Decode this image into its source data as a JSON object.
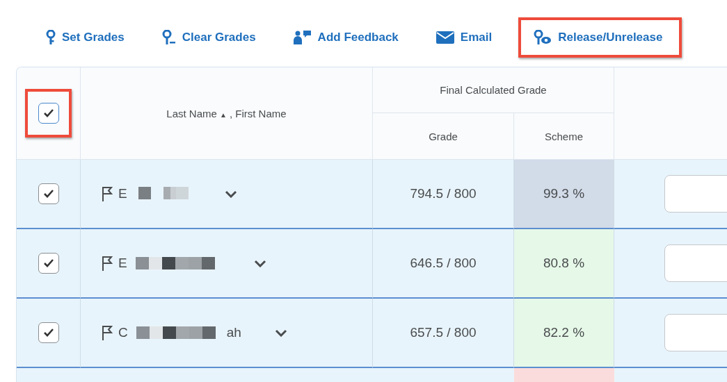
{
  "toolbar": [
    {
      "kind": "pin",
      "label": "Set Grades",
      "highlighted": false
    },
    {
      "kind": "pin-minus",
      "label": "Clear Grades",
      "highlighted": false
    },
    {
      "kind": "feedback",
      "label": "Add Feedback",
      "highlighted": false
    },
    {
      "kind": "mail",
      "label": "Email",
      "highlighted": false
    },
    {
      "kind": "pin-eye",
      "label": "Release/Unrelease",
      "highlighted": true
    }
  ],
  "table": {
    "select_all": {
      "checked": true,
      "highlighted": true
    },
    "name_header": {
      "sort_label": "Last Name",
      "sort_icon": "▲",
      "rest": ", First Name"
    },
    "group_header": "Final Calculated Grade",
    "columns": [
      "Grade",
      "Scheme"
    ],
    "rows": [
      {
        "checked": true,
        "name_parts": [
          {
            "kind": "text",
            "text": "E"
          },
          {
            "kind": "redaction"
          }
        ],
        "grade": "794.5 / 800",
        "scheme": "99.3 %",
        "color": "#d2dbe8"
      },
      {
        "checked": true,
        "name_parts": [
          {
            "kind": "text",
            "text": "E"
          },
          {
            "kind": "redaction"
          }
        ],
        "grade": "646.5 / 800",
        "scheme": "80.8 %",
        "color": "#e6f8e8"
      },
      {
        "checked": true,
        "name_parts": [
          {
            "kind": "text",
            "text": "C"
          },
          {
            "kind": "redaction"
          },
          {
            "kind": "text",
            "text": "ah"
          }
        ],
        "grade": "657.5 / 800",
        "scheme": "82.2 %",
        "color": "#e6f8e8"
      }
    ],
    "partial_row": {
      "color": "#fbdcdc"
    }
  }
}
